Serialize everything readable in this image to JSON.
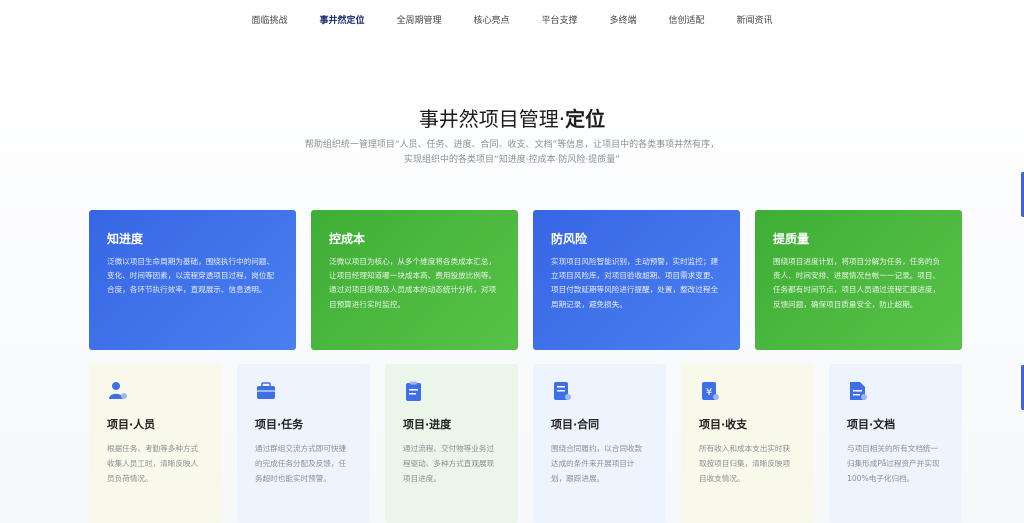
{
  "nav": {
    "items": [
      {
        "label": "面临挑战",
        "active": false
      },
      {
        "label": "事井然定位",
        "active": true
      },
      {
        "label": "全周期管理",
        "active": false
      },
      {
        "label": "核心亮点",
        "active": false
      },
      {
        "label": "平台支撑",
        "active": false
      },
      {
        "label": "多终端",
        "active": false
      },
      {
        "label": "信创适配",
        "active": false
      },
      {
        "label": "新闻资讯",
        "active": false
      }
    ]
  },
  "hero": {
    "title_main": "事井然项目管理·",
    "title_strong": "定位",
    "subtitle_line1": "帮助组织统一管理项目“人员、任务、进度、合同、收支、文档”等信息，让项目中的各类事项井然有序，",
    "subtitle_line2": "实现组织中的各类项目“知进度·控成本·防风险·提质量”"
  },
  "big_cards": [
    {
      "title": "知进度",
      "text": "泛微以项目生命周期为基础，围绕执行中的问题、变化、时间等因素，以流程穿透项目过程，岗位配合度，各环节执行效率，直观展示、信息透明。"
    },
    {
      "title": "控成本",
      "text": "泛微以项目为核心，从多个维度将各类成本汇总，让项目经理知道哪一块成本高、费用投放比例等。通过对项目采购及人员成本的动态统计分析，对项目预算进行实时监控。"
    },
    {
      "title": "防风险",
      "text": "实现项目风险智能识别，主动预警，实时监控；建立项目风险库，对项目验收超期、项目需求变更、项目付款延期等风险进行提醒，处置，整改过程全周期记录，避免损失。"
    },
    {
      "title": "提质量",
      "text": "围绕项目进度计划，将项目分解为任务，任务的负责人、时间安排、进展情况台帐一一记录。项目、任务都有时间节点，项目人员通过流程汇报进度，反馈问题，确保项目质量安全，防止超期。"
    }
  ],
  "small_cards": [
    {
      "icon": "person-icon",
      "title": "项目·人员",
      "text": "根据任务、考勤等多种方式收集人员工时，清晰反映人员负荷情况。"
    },
    {
      "icon": "briefcase-icon",
      "title": "项目·任务",
      "text": "通过群组交流方式即可快捷的完成任务分配及反馈，任务超时也能实时预警。"
    },
    {
      "icon": "clipboard-icon",
      "title": "项目·进度",
      "text": "通过流程、交付物等业务过程驱动、多种方式直观展现项目进度。"
    },
    {
      "icon": "contract-icon",
      "title": "项目·合同",
      "text": "围绕合同履约，以合同收款达成的条件来开展项目计划，跟踪进展。"
    },
    {
      "icon": "yen-icon",
      "title": "项目·收支",
      "text": "所有收入和成本支出实时获取按项目归集，清晰反映项目收支情况。"
    },
    {
      "icon": "document-icon",
      "title": "项目·文档",
      "text": "与项目相关的所有文档统一归集形成På过程资产并实现100%电子化归档。"
    }
  ],
  "colors": {
    "accent_blue": "#3766e4",
    "accent_green": "#3fae36",
    "nav_active": "#1a2a6e"
  }
}
